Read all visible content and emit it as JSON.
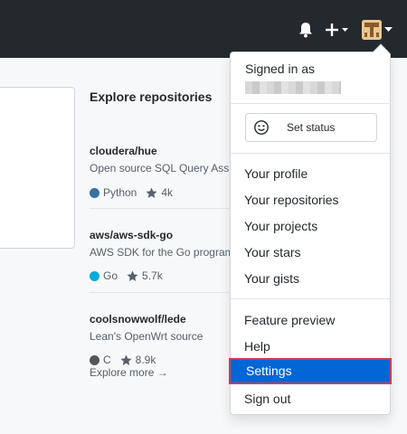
{
  "header": {
    "notifications_icon": "bell-icon",
    "create_icon": "plus-icon",
    "avatar_icon": "user-avatar"
  },
  "explore": {
    "title": "Explore repositories",
    "repos": [
      {
        "name": "cloudera/hue",
        "description": "Open source SQL Query Assis",
        "language": "Python",
        "language_color": "#3572a5",
        "stars": "4k"
      },
      {
        "name": "aws/aws-sdk-go",
        "description": "AWS SDK for the Go program",
        "language": "Go",
        "language_color": "#00add8",
        "stars": "5.7k"
      },
      {
        "name": "coolsnowwolf/lede",
        "description": "Lean's OpenWrt source",
        "language": "C",
        "language_color": "#555555",
        "stars": "8.9k"
      }
    ],
    "more_link": "Explore more →"
  },
  "menu": {
    "signed_in_label": "Signed in as",
    "set_status_label": "Set status",
    "items": [
      "Your profile",
      "Your repositories",
      "Your projects",
      "Your stars",
      "Your gists",
      "Feature preview",
      "Help",
      "Settings",
      "Sign out"
    ],
    "active_item": "Settings",
    "highlight_color": "#0366d6",
    "outline_color": "#d73a49"
  }
}
